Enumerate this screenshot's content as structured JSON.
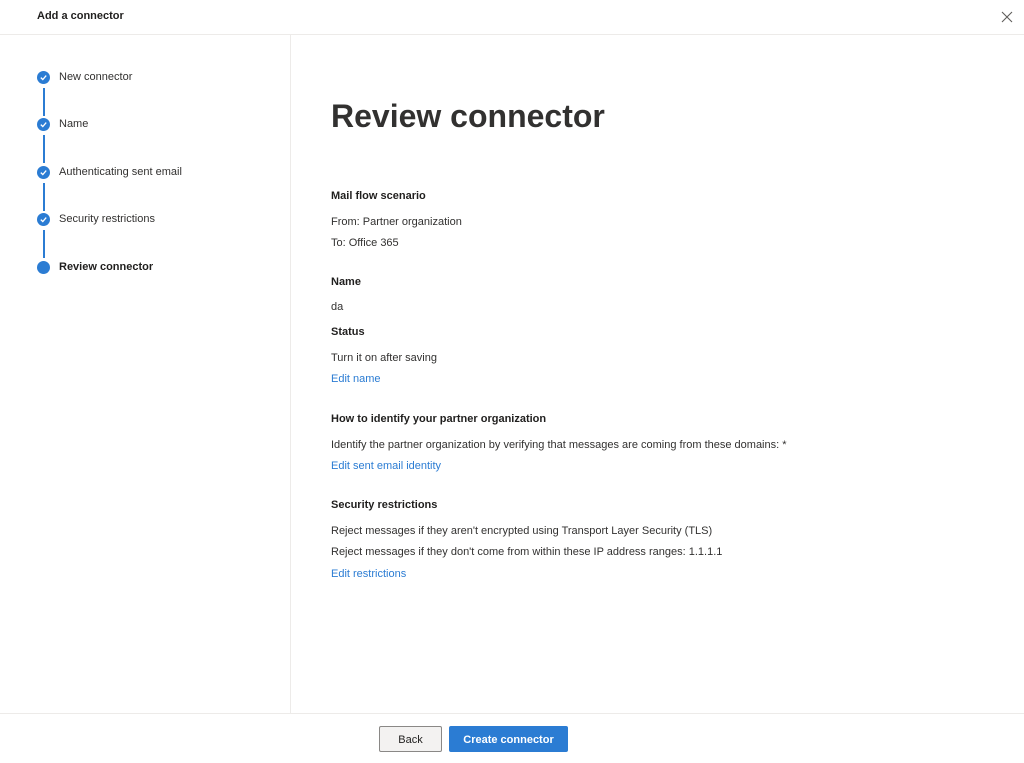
{
  "window": {
    "title": "Add a connector"
  },
  "steps": [
    {
      "label": "New connector",
      "state": "done"
    },
    {
      "label": "Name",
      "state": "done"
    },
    {
      "label": "Authenticating sent email",
      "state": "done"
    },
    {
      "label": "Security restrictions",
      "state": "done"
    },
    {
      "label": "Review connector",
      "state": "current"
    }
  ],
  "main": {
    "title": "Review connector",
    "mail_flow": {
      "heading": "Mail flow scenario",
      "from": "From: Partner organization",
      "to": "To: Office 365"
    },
    "name": {
      "heading": "Name",
      "value": "da"
    },
    "status": {
      "heading": "Status",
      "value": "Turn it on after saving",
      "edit_link": "Edit name"
    },
    "identify": {
      "heading": "How to identify your partner organization",
      "value": "Identify the partner organization by verifying that messages are coming from these domains: *",
      "edit_link": "Edit sent email identity"
    },
    "security": {
      "heading": "Security restrictions",
      "line1": "Reject messages if they aren't encrypted using Transport Layer Security (TLS)",
      "line2": "Reject messages if they don't come from within these IP address ranges: 1.1.1.1",
      "edit_link": "Edit restrictions"
    }
  },
  "footer": {
    "back_label": "Back",
    "create_label": "Create connector"
  },
  "colors": {
    "accent": "#2b7cd3"
  }
}
